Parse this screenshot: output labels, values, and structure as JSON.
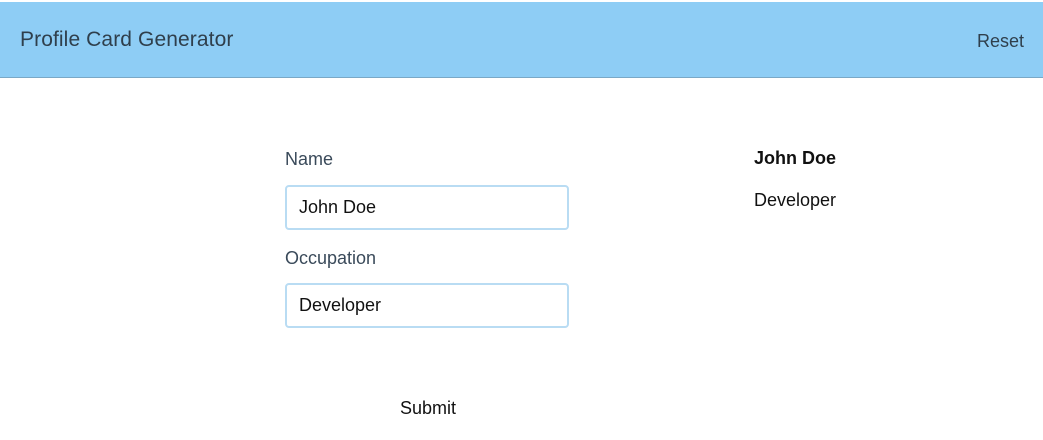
{
  "header": {
    "title": "Profile Card Generator",
    "reset_label": "Reset",
    "background_color": "#8ecdf5"
  },
  "form": {
    "name_label": "Name",
    "name_value": "John Doe",
    "occupation_label": "Occupation",
    "occupation_value": "Developer",
    "submit_label": "Submit"
  },
  "preview": {
    "name": "John Doe",
    "occupation": "Developer"
  }
}
